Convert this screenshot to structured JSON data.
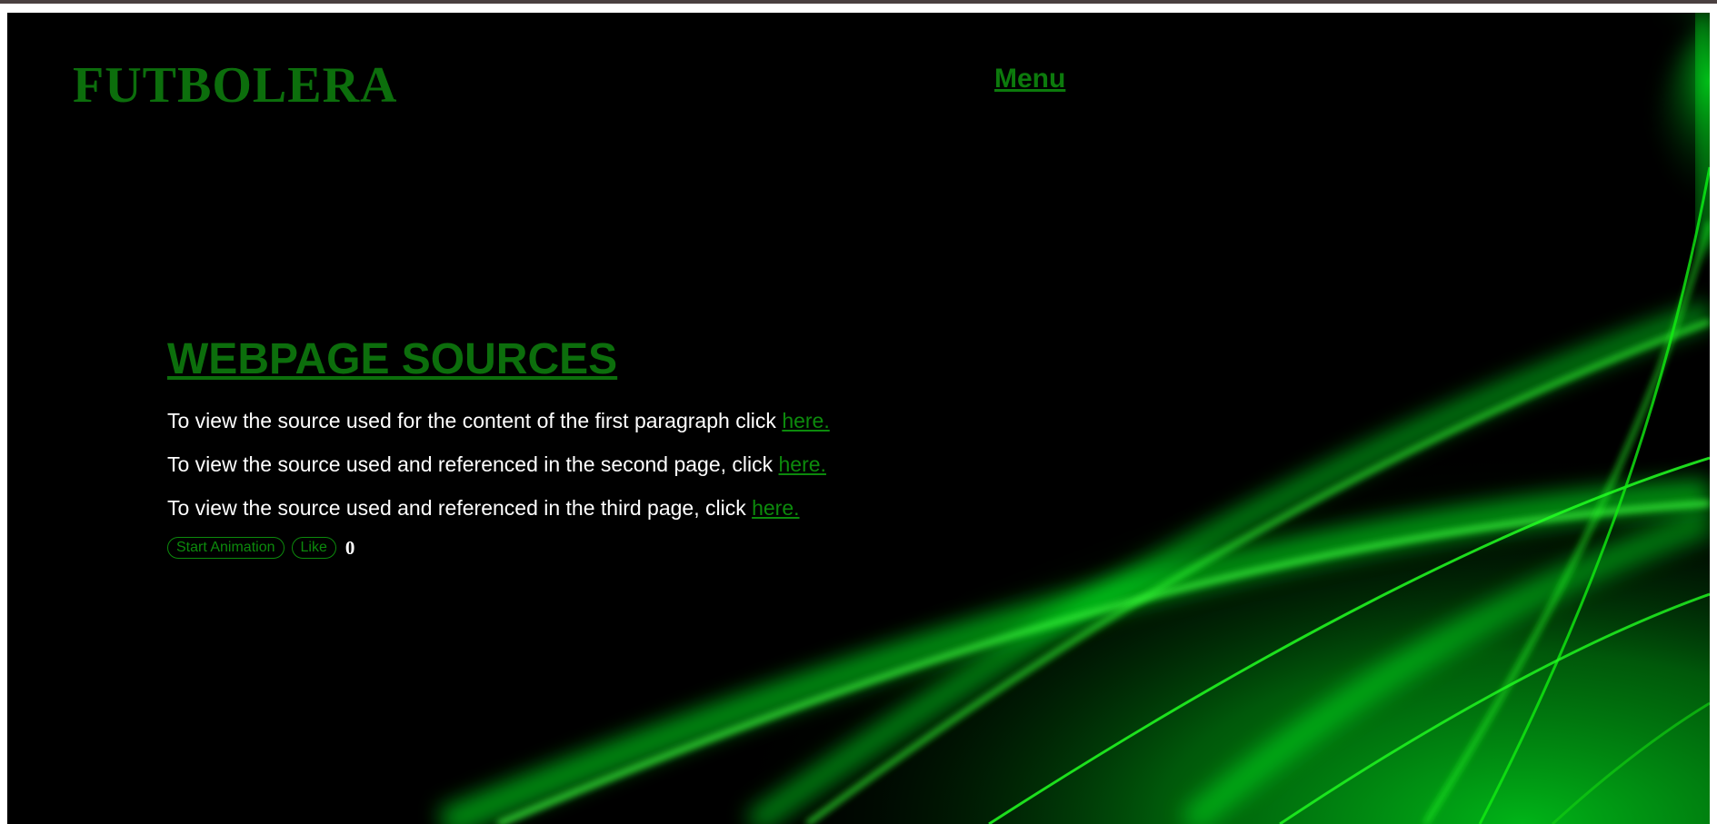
{
  "site": {
    "title": "FUTBOLERA",
    "menu_label": "Menu"
  },
  "main": {
    "heading": "WEBPAGE SOURCES",
    "paragraphs": [
      {
        "text": "To view the source used for the content of the first paragraph click ",
        "link": "here."
      },
      {
        "text": "To view the source used and referenced in the second page, click ",
        "link": "here."
      },
      {
        "text": "To view the source used and referenced in the third page, click ",
        "link": "here."
      }
    ],
    "start_animation_label": "Start Animation",
    "like_label": "Like",
    "like_count": "0"
  },
  "colors": {
    "background": "#000000",
    "accent_green": "#0c6e0c",
    "glow_green": "#00ff22",
    "text": "#ffffff"
  }
}
